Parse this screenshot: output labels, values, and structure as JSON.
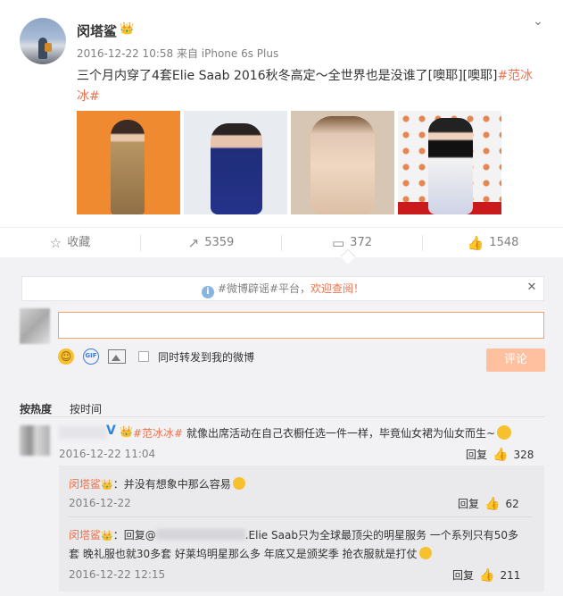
{
  "post": {
    "username": "闵塔鲨",
    "vip_badge": "👑",
    "meta": "2016-12-22 10:58 来自 iPhone 6s Plus",
    "text_main": "三个月内穿了4套Elie Saab 2016秋冬高定～全世界也是没谁了[噢耶][噢耶]",
    "hashtag_part1": "#范冰",
    "hashtag_part2": "冰#",
    "images": [
      "orange-gown-photo",
      "blue-gown-photo",
      "beige-feather-gown-photo",
      "floral-gown-photo"
    ]
  },
  "actions": {
    "favorite_label": "收藏",
    "repost_count": "5359",
    "comment_count": "372",
    "like_count": "1548"
  },
  "comment_section": {
    "notice_prefix": "#微博辟谣#平台，",
    "notice_link": "欢迎查阅！",
    "input_value": "",
    "sync_label": "同时转发到我的微博",
    "submit_label": "评论",
    "sort_hot": "按热度",
    "sort_time": "按时间"
  },
  "comments": [
    {
      "verified_mark": "V",
      "vip_badge": "👑",
      "hashtag": "#范冰冰#",
      "text": " 就像出席活动在自己衣橱任选一件一样，毕竟仙女裙为仙女而生~",
      "time": "2016-12-22 11:04",
      "reply_label": "回复",
      "likes": "328"
    }
  ],
  "replies": [
    {
      "name": "闵塔鲨",
      "vip_badge": "👑",
      "text": "：并没有想象中那么容易",
      "time": "2016-12-22",
      "reply_label": "回复",
      "likes": "62"
    },
    {
      "name": "闵塔鲨",
      "vip_badge": "👑",
      "text_prefix": "：回复@",
      "text_line1_rest": ".Elie Saab只为全球最顶尖的明星服务 一个系列只有50多",
      "text_line2": "套 晚礼服也就30多套 好莱坞明星那么多 年底又是颁奖季 抢衣服就是打仗",
      "time": "2016-12-22 12:15",
      "reply_label": "回复",
      "likes": "211"
    }
  ]
}
